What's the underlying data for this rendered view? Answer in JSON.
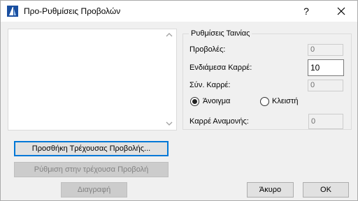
{
  "window": {
    "title": "Προ-Ρυθμίσεις Προβολών",
    "help_label": "?"
  },
  "group": {
    "title": "Ρυθμίσεις Ταινίας",
    "views_label": "Προβολές:",
    "views_value": "0",
    "intermediate_label": "Ενδιάμεσα Καρρέ:",
    "intermediate_value": "10",
    "total_label": "Σύν. Καρρέ:",
    "total_value": "0",
    "open_label": "Άνοιγμα",
    "closed_label": "Κλειστή",
    "selected_mode": "open",
    "wait_label": "Καρρέ Αναμονής:",
    "wait_value": "0"
  },
  "buttons": {
    "add_current": "Προσθήκη Τρέχουσας Προβολής...",
    "set_current": "Ρύθμιση στην τρέχουσα Προβολή",
    "delete": "Διαγραφή",
    "cancel": "Άκυρο",
    "ok": "OK"
  },
  "colors": {
    "accent": "#0078d7",
    "disabled_text": "#838383",
    "app_icon": "#1a4fa0"
  },
  "icons": {
    "app": "archicad-icon",
    "close": "close-icon",
    "scroll_up": "chevron-up-icon",
    "scroll_down": "chevron-down-icon"
  }
}
